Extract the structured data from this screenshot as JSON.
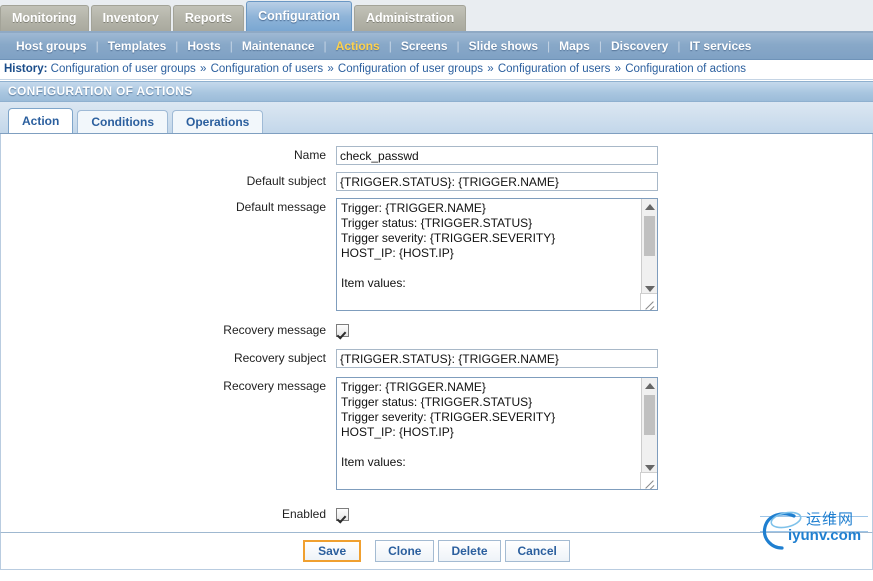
{
  "main_menu": {
    "items": [
      {
        "label": "Monitoring",
        "active": false
      },
      {
        "label": "Inventory",
        "active": false
      },
      {
        "label": "Reports",
        "active": false
      },
      {
        "label": "Configuration",
        "active": true
      },
      {
        "label": "Administration",
        "active": false
      }
    ]
  },
  "sub_menu": {
    "items": [
      {
        "label": "Host groups",
        "current": false
      },
      {
        "label": "Templates",
        "current": false
      },
      {
        "label": "Hosts",
        "current": false
      },
      {
        "label": "Maintenance",
        "current": false
      },
      {
        "label": "Actions",
        "current": true
      },
      {
        "label": "Screens",
        "current": false
      },
      {
        "label": "Slide shows",
        "current": false
      },
      {
        "label": "Maps",
        "current": false
      },
      {
        "label": "Discovery",
        "current": false
      },
      {
        "label": "IT services",
        "current": false
      }
    ],
    "separator": "|"
  },
  "history": {
    "label": "History:",
    "separator": "»",
    "items": [
      "Configuration of user groups",
      "Configuration of users",
      "Configuration of user groups",
      "Configuration of users",
      "Configuration of actions"
    ]
  },
  "page_header": {
    "title": "CONFIGURATION OF ACTIONS"
  },
  "form_tabs": {
    "items": [
      {
        "label": "Action",
        "active": true
      },
      {
        "label": "Conditions",
        "active": false
      },
      {
        "label": "Operations",
        "active": false
      }
    ]
  },
  "form": {
    "name": {
      "label": "Name",
      "value": "check_passwd"
    },
    "default_subject": {
      "label": "Default subject",
      "value": "{TRIGGER.STATUS}: {TRIGGER.NAME}"
    },
    "default_message": {
      "label": "Default message",
      "value": "Trigger: {TRIGGER.NAME}\nTrigger status: {TRIGGER.STATUS}\nTrigger severity: {TRIGGER.SEVERITY}\nHOST_IP: {HOST.IP}\n\nItem values:"
    },
    "recovery_message_toggle": {
      "label": "Recovery message",
      "checked": true
    },
    "recovery_subject": {
      "label": "Recovery subject",
      "value": "{TRIGGER.STATUS}: {TRIGGER.NAME}"
    },
    "recovery_message": {
      "label": "Recovery message",
      "value": "Trigger: {TRIGGER.NAME}\nTrigger status: {TRIGGER.STATUS}\nTrigger severity: {TRIGGER.SEVERITY}\nHOST_IP: {HOST.IP}\n\nItem values:"
    },
    "enabled": {
      "label": "Enabled",
      "checked": true
    }
  },
  "footer": {
    "save": "Save",
    "clone": "Clone",
    "delete": "Delete",
    "cancel": "Cancel"
  },
  "watermark": {
    "cn": "运维网",
    "en": "iyunv.com"
  },
  "colors": {
    "accent_blue": "#2b5f9e",
    "active_tab_blue": "#8fb4d8",
    "submenu_current": "#ffd24d",
    "save_border": "#f0a030",
    "watermark": "#1f7fd0"
  }
}
